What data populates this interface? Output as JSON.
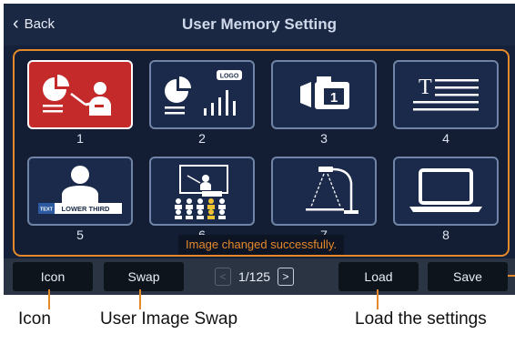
{
  "header": {
    "back_label": "Back",
    "title": "User Memory Setting"
  },
  "tiles": [
    {
      "number": "1",
      "icon": "presenter-chart-icon",
      "selected": true
    },
    {
      "number": "2",
      "icon": "chart-logo-icon",
      "logo_text": "LOGO"
    },
    {
      "number": "3",
      "icon": "camera-preset-icon",
      "badge": "1"
    },
    {
      "number": "4",
      "icon": "text-layout-icon",
      "glyph": "T"
    },
    {
      "number": "5",
      "icon": "lower-third-icon",
      "tag_text": "TEXT",
      "banner_text": "LOWER THIRD"
    },
    {
      "number": "6",
      "icon": "classroom-icon"
    },
    {
      "number": "7",
      "icon": "document-camera-icon"
    },
    {
      "number": "8",
      "icon": "laptop-icon"
    }
  ],
  "toast": "Image changed successfully.",
  "toolbar": {
    "icon_label": "Icon",
    "swap_label": "Swap",
    "page_indicator": "1/125",
    "load_label": "Load",
    "save_label": "Save"
  },
  "callouts": {
    "icon": "Icon",
    "swap": "User Image Swap",
    "load": "Load the settings"
  },
  "colors": {
    "accent": "#e6892a",
    "selected": "#c42a2a",
    "background": "#15213a"
  }
}
